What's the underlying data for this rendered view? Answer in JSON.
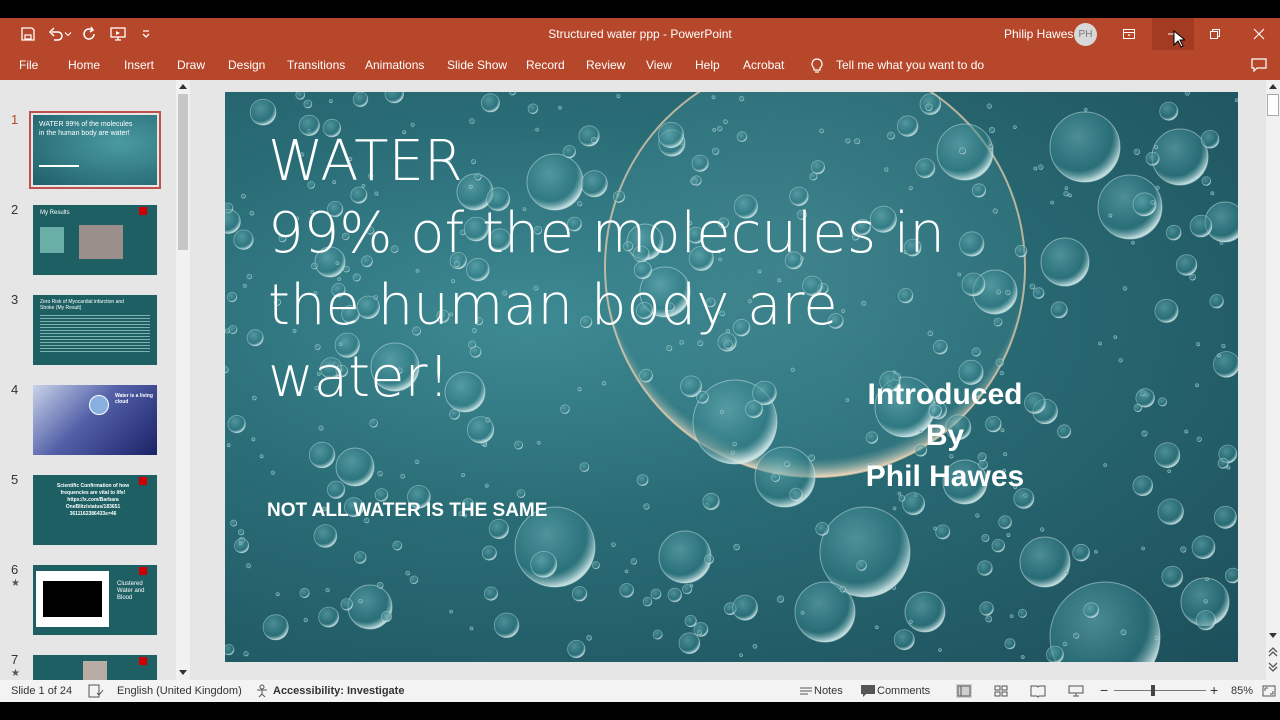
{
  "window": {
    "doc_title": "Structured water ppp  -  PowerPoint",
    "user_name": "Philip Hawes",
    "user_initials": "PH"
  },
  "ribbon": {
    "tabs": [
      "File",
      "Home",
      "Insert",
      "Draw",
      "Design",
      "Transitions",
      "Animations",
      "Slide Show",
      "Record",
      "Review",
      "View",
      "Help",
      "Acrobat"
    ],
    "tell_me": "Tell me what you want to do"
  },
  "thumbnails": [
    {
      "number": "1",
      "star": false,
      "text": "WATER 99% of the molecules in the human body are water!"
    },
    {
      "number": "2",
      "star": false,
      "text": "My Results"
    },
    {
      "number": "3",
      "star": false,
      "text": "Zero Risk of Myocardial infarction and Stroke (My Result)"
    },
    {
      "number": "4",
      "star": false,
      "text": "Water is a living cloud"
    },
    {
      "number": "5",
      "star": false,
      "text": "Scientific Confirmation of how frequencies are vital to life! https://x.com/Barbara OneBlitz/status/183651 3611162386433s=46"
    },
    {
      "number": "6",
      "star": true,
      "text": "Clustered Water and Blood"
    },
    {
      "number": "7",
      "star": true,
      "text": ""
    }
  ],
  "slide": {
    "heading": "WATER",
    "body_lines": [
      "99% of the molecules in",
      "the human body are",
      "water!"
    ],
    "intro_lines": [
      "Introduced",
      "By",
      "Phil Hawes"
    ],
    "subtitle": "NOT ALL WATER IS THE SAME"
  },
  "statusbar": {
    "slide_info": "Slide 1 of 24",
    "language": "English (United Kingdom)",
    "accessibility": "Accessibility: Investigate",
    "notes": "Notes",
    "comments": "Comments",
    "zoom": "85%",
    "zoom_fraction": 0.42
  },
  "colors": {
    "accent": "#b7472a",
    "slide_bg": "#2a6d77"
  }
}
